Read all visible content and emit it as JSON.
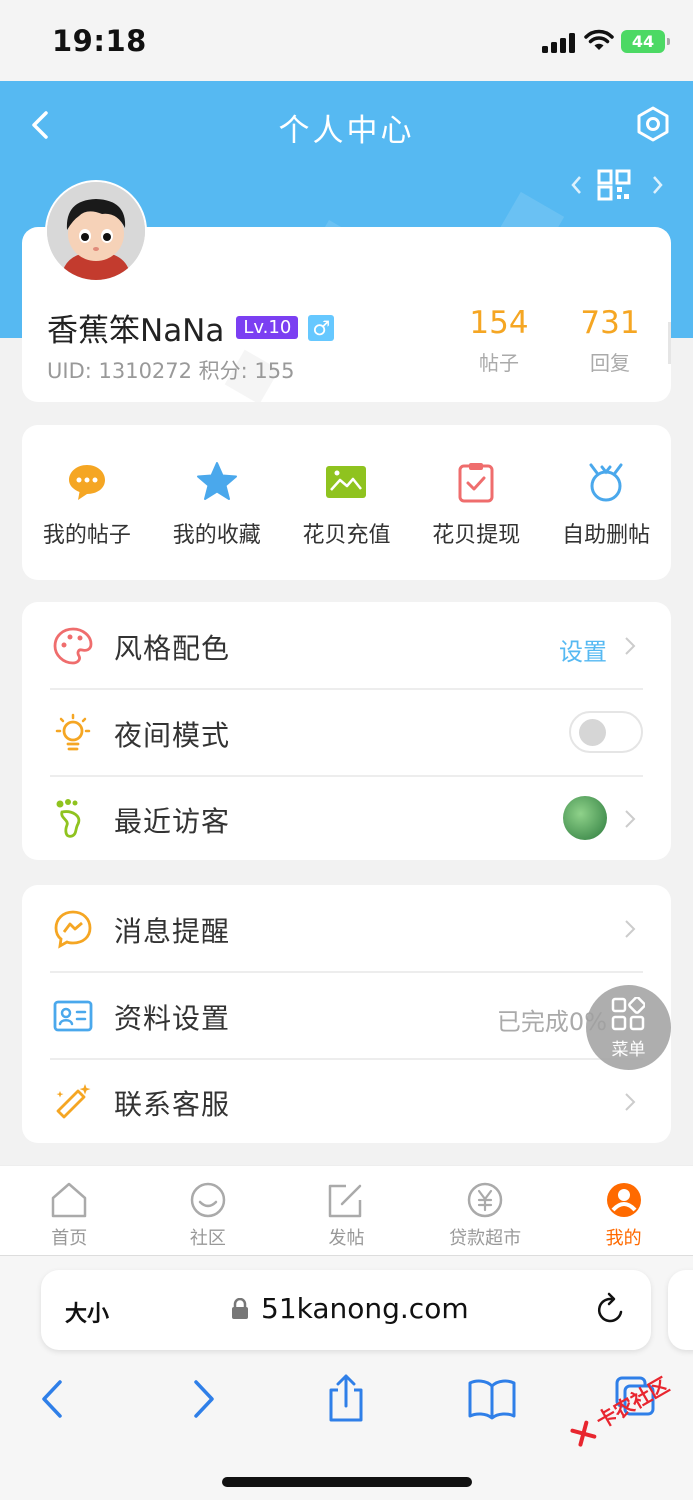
{
  "status_bar": {
    "time": "19:18",
    "battery": "44"
  },
  "header": {
    "title": "个人中心"
  },
  "profile": {
    "name": "香蕉笨NaNa",
    "level": "Lv.10",
    "gender_symbol": "♂",
    "uid_line": "UID: 1310272   积分: 155",
    "stats": [
      {
        "value": "154",
        "label": "帖子"
      },
      {
        "value": "731",
        "label": "回复"
      }
    ]
  },
  "quick_actions": [
    {
      "label": "我的帖子",
      "icon": "chat-bubble-icon",
      "color": "#f5a623"
    },
    {
      "label": "我的收藏",
      "icon": "star-icon",
      "color": "#4aa8ec"
    },
    {
      "label": "花贝充值",
      "icon": "image-icon",
      "color": "#8fc31f"
    },
    {
      "label": "花贝提现",
      "icon": "clipboard-check-icon",
      "color": "#ef6d6d"
    },
    {
      "label": "自助删帖",
      "icon": "alarm-icon",
      "color": "#4aa8ec"
    }
  ],
  "settings_group_1": {
    "style": {
      "label": "风格配色",
      "value": "设置"
    },
    "night": {
      "label": "夜间模式",
      "enabled": false
    },
    "visitors": {
      "label": "最近访客"
    }
  },
  "settings_group_2": {
    "messages": {
      "label": "消息提醒"
    },
    "profile": {
      "label": "资料设置",
      "value": "已完成0%"
    },
    "service": {
      "label": "联系客服"
    }
  },
  "float_menu": {
    "label": "菜单"
  },
  "tabbar": [
    {
      "label": "首页",
      "icon": "home-icon",
      "active": false
    },
    {
      "label": "社区",
      "icon": "smile-chat-icon",
      "active": false
    },
    {
      "label": "发帖",
      "icon": "edit-icon",
      "active": false
    },
    {
      "label": "贷款超市",
      "icon": "yen-icon",
      "active": false
    },
    {
      "label": "我的",
      "icon": "user-icon",
      "active": true
    }
  ],
  "browser": {
    "text_size": "大小",
    "url": "51kanong.com"
  },
  "watermark": "卡农社区",
  "colors": {
    "header": "#56b9f2",
    "accent": "#f5a623",
    "active_tab": "#ff6a00",
    "level_badge": "#7b3ff2"
  }
}
